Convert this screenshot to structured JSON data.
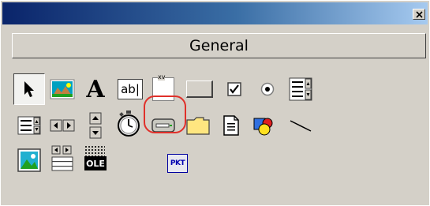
{
  "window": {
    "close_glyph": "×"
  },
  "tab": {
    "label": "General"
  },
  "tools": {
    "row1": [
      {
        "name": "pointer-icon",
        "text": ""
      },
      {
        "name": "picturebox-icon",
        "text": ""
      },
      {
        "name": "label-icon",
        "text": "A"
      },
      {
        "name": "textbox-icon",
        "text": "ab|"
      },
      {
        "name": "frame-icon",
        "text": "xv"
      },
      {
        "name": "commandbutton-icon",
        "text": ""
      },
      {
        "name": "checkbox-icon",
        "text": ""
      },
      {
        "name": "optionbutton-icon",
        "text": ""
      },
      {
        "name": "combobox-icon",
        "text": ""
      }
    ],
    "row2": [
      {
        "name": "listbox-icon",
        "text": ""
      },
      {
        "name": "hscrollbar-icon",
        "text": ""
      },
      {
        "name": "vscrollbar-icon",
        "text": ""
      },
      {
        "name": "timer-icon",
        "text": ""
      },
      {
        "name": "drivelistbox-icon",
        "text": ""
      },
      {
        "name": "dirlistbox-icon",
        "text": ""
      },
      {
        "name": "filelistbox-icon",
        "text": ""
      },
      {
        "name": "shape-icon",
        "text": ""
      },
      {
        "name": "line-icon",
        "text": ""
      }
    ],
    "row3": [
      {
        "name": "image-icon",
        "text": ""
      },
      {
        "name": "data-icon",
        "text": ""
      },
      {
        "name": "ole-icon",
        "text": "OLE"
      },
      {
        "name": "pkt-control-icon",
        "text": "PKT"
      }
    ]
  },
  "colors": {
    "highlight": "#e0302a",
    "title_start": "#0a246a",
    "title_end": "#a6caf0"
  }
}
